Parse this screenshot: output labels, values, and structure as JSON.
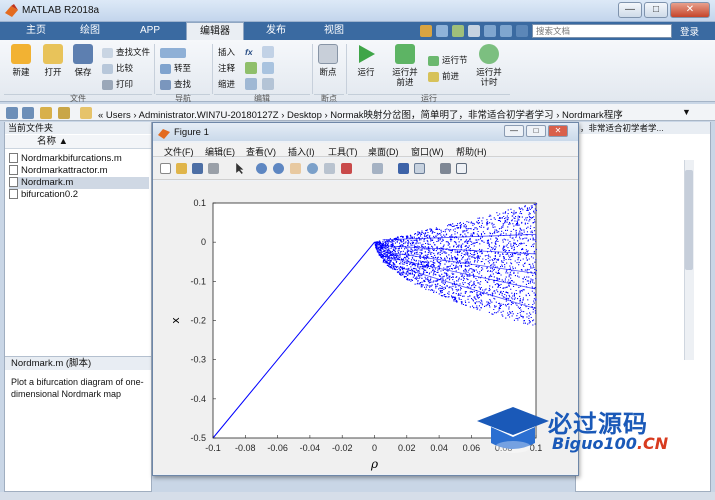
{
  "window": {
    "title": "MATLAB R2018a",
    "controls": [
      "—",
      "□",
      "✕"
    ]
  },
  "tabs": [
    {
      "label": "主页"
    },
    {
      "label": "绘图"
    },
    {
      "label": "APP"
    },
    {
      "label": "编辑器"
    },
    {
      "label": "发布"
    },
    {
      "label": "视图"
    }
  ],
  "search": {
    "placeholder": "搜索文档"
  },
  "help": "登录",
  "toolstrip": {
    "file": {
      "section": "文件",
      "new": "新建",
      "open": "打开",
      "save": "保存",
      "find_files": "查找文件",
      "compare": "比较",
      "print": "打印"
    },
    "navigate": {
      "section": "导航",
      "goto": "转至",
      "find": "查找"
    },
    "edit": {
      "section": "编辑",
      "insert": "插入",
      "comment": "注释",
      "indent": "缩进",
      "fx": "fx"
    },
    "breakpoints": {
      "section": "断点",
      "label": "断点"
    },
    "run": {
      "section": "运行",
      "run": "运行",
      "run_advance": "运行并\n前进",
      "run_section": "运行节",
      "advance": "前进",
      "run_time": "运行并\n计时"
    }
  },
  "address": {
    "path": "« Users › Administrator.WIN7U-20180127Z › Desktop › Normak映射分岔图，简单明了，非常适合初学者学习 › Nordmark程序"
  },
  "current_folder": {
    "header": "当前文件夹",
    "column": "名称 ▲",
    "files": [
      {
        "name": "Nordmarkbifurcations.m"
      },
      {
        "name": "Nordmarkattractor.m"
      },
      {
        "name": "Nordmark.m"
      },
      {
        "name": "bifurcation0.2"
      }
    ]
  },
  "details": {
    "header": "Nordmark.m  (脚本)",
    "text": "Plot a bifurcation diagram of one-dimensional Nordmark map"
  },
  "workspace": {
    "header": "，非常适合初学者学..."
  },
  "figure": {
    "title": "Figure 1",
    "menu": [
      "文件(F)",
      "编辑(E)",
      "查看(V)",
      "插入(I)",
      "工具(T)",
      "桌面(D)",
      "窗口(W)",
      "帮助(H)"
    ]
  },
  "watermark": {
    "line1": "必过源码",
    "line2_a": "Biguo100",
    "line2_b": ".CN"
  },
  "chart_data": {
    "type": "scatter",
    "xlabel": "ρ",
    "ylabel": "x",
    "xlim": [
      -0.1,
      0.1
    ],
    "ylim": [
      -0.5,
      0.1
    ],
    "xticks": [
      "-0.1",
      "-0.08",
      "-0.06",
      "-0.04",
      "-0.02",
      "0",
      "0.02",
      "0.04",
      "0.06",
      "0.08",
      "0.1"
    ],
    "yticks": [
      "0.1",
      "0",
      "-0.1",
      "-0.2",
      "-0.3",
      "-0.4",
      "-0.5"
    ],
    "series": [
      {
        "segment": "stable-branch",
        "x": [
          -0.1,
          0
        ],
        "y": [
          -0.5,
          0
        ]
      },
      {
        "segment": "chaotic-region",
        "x_range": [
          0,
          0.1
        ],
        "upper_y": 0.1,
        "lower_y_at_max": -0.22
      }
    ],
    "color": "#0000ff"
  }
}
